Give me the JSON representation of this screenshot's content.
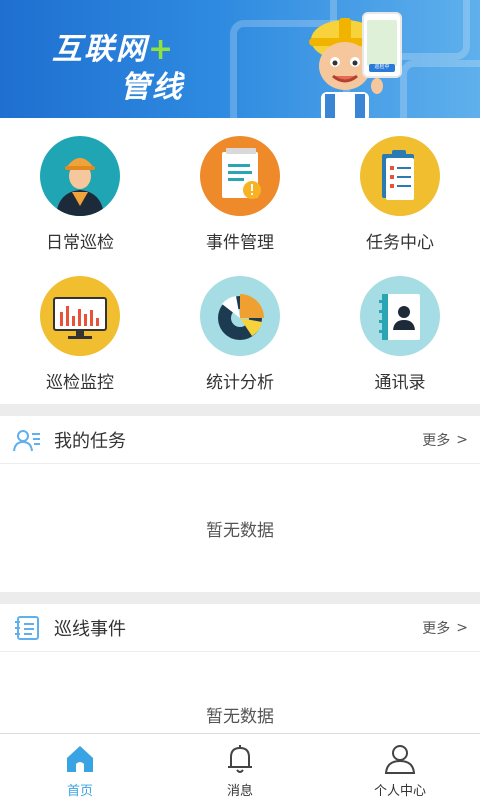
{
  "banner": {
    "title_line1": "互联网",
    "title_plus": "+",
    "title_line2": "管线",
    "phone_button_label": "巡检中"
  },
  "grid": {
    "items": [
      {
        "label": "日常巡检",
        "icon": "worker-icon",
        "color": "#1fa5b3"
      },
      {
        "label": "事件管理",
        "icon": "document-alert-icon",
        "color": "#ef8a2a"
      },
      {
        "label": "任务中心",
        "icon": "clipboard-checklist-icon",
        "color": "#f0be2f"
      },
      {
        "label": "巡检监控",
        "icon": "monitor-chart-icon",
        "color": "#f0be2f"
      },
      {
        "label": "统计分析",
        "icon": "pie-chart-icon",
        "color": "#a6dde4"
      },
      {
        "label": "通讯录",
        "icon": "contacts-book-icon",
        "color": "#a6dde4"
      }
    ]
  },
  "sections": {
    "tasks": {
      "title": "我的任务",
      "more": "更多",
      "more_chevron": ">",
      "empty_text": "暂无数据"
    },
    "events": {
      "title": "巡线事件",
      "more": "更多",
      "more_chevron": ">",
      "empty_text": "暂无数据"
    }
  },
  "bottom_nav": {
    "items": [
      {
        "label": "首页",
        "icon": "home-icon",
        "active": true
      },
      {
        "label": "消息",
        "icon": "bell-icon",
        "active": false
      },
      {
        "label": "个人中心",
        "icon": "person-icon",
        "active": false
      }
    ]
  },
  "colors": {
    "accent": "#3aa3e3",
    "banner_blue": "#2e8ae0",
    "separator": "#ececec"
  }
}
